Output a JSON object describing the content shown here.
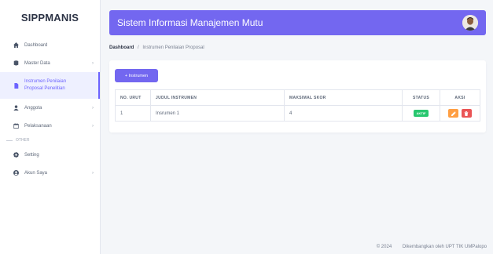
{
  "sidebar": {
    "brand": "SIPPMANIS",
    "items": [
      {
        "label": "Dashboard",
        "icon": "home-icon"
      },
      {
        "label": "Master Data",
        "icon": "database-icon",
        "chevron": "›"
      },
      {
        "label_line1": "Instrumen Penilaian",
        "label_line2": "Proposal Penelitian",
        "icon": "file-icon"
      },
      {
        "label": "Anggota",
        "icon": "user-icon",
        "chevron": "›"
      },
      {
        "label": "Pelaksanaan",
        "icon": "calendar-icon",
        "chevron": "›"
      },
      {
        "label": "Setting",
        "icon": "gear-icon"
      },
      {
        "label": "Akun Saya",
        "icon": "account-icon",
        "chevron": "›"
      }
    ],
    "section_other": "OTHER"
  },
  "header": {
    "title": "Sistem Informasi Manajemen Mutu",
    "accent": "#7367f0"
  },
  "breadcrumb": {
    "root": "Dashboard",
    "separator": "/",
    "current": "Instrumen Penilaian Proposal"
  },
  "card": {
    "add_button": "+ Instrumen",
    "columns": [
      "NO. URUT",
      "JUDUL INSTRUMEN",
      "MAKSIMAL SKOR",
      "STATUS",
      "AKSI"
    ],
    "rows": [
      {
        "no": "1",
        "judul": "Insrumen 1",
        "skor": "4",
        "status": "AKTIF"
      }
    ]
  },
  "footer": {
    "year": "© 2024",
    "credit": "Dikembangkan oleh UPT TIK UMPalopo"
  }
}
